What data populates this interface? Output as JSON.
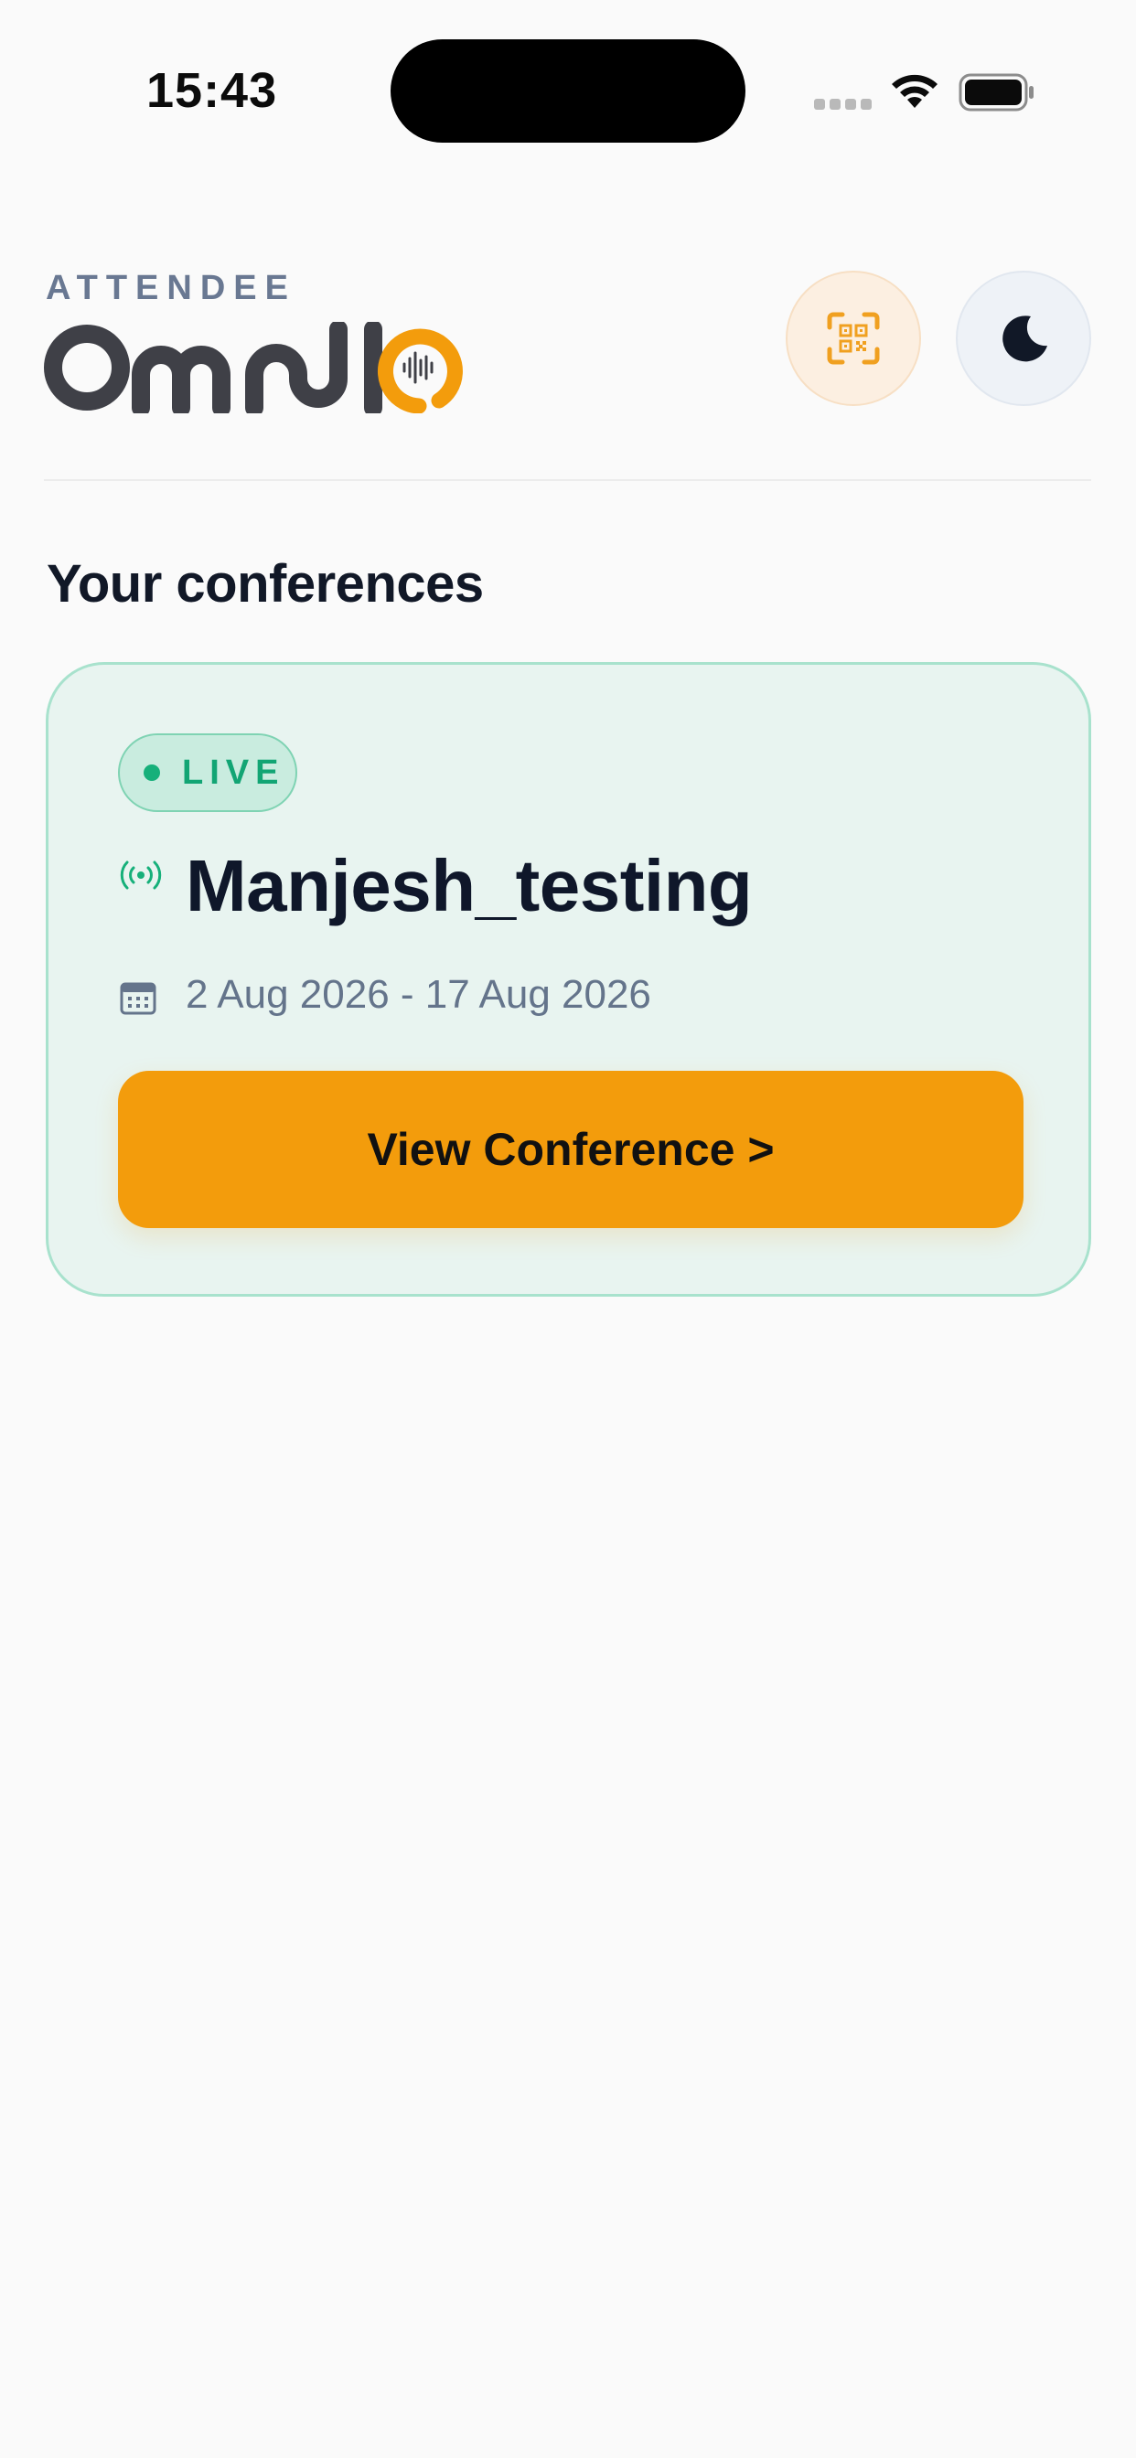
{
  "status_bar": {
    "time": "15:43",
    "icons": [
      "cellular-signal-icon",
      "wifi-icon",
      "battery-icon"
    ]
  },
  "header": {
    "brand_sub": "ATTENDEE",
    "brand_name": "OMNIO",
    "brand_colors": {
      "wordmark": "#3f4047",
      "accent": "#f39c0c"
    },
    "qr_button_icon": "qr-scan-icon",
    "theme_button_icon": "moon-icon"
  },
  "main": {
    "section_title": "Your conferences",
    "conferences": [
      {
        "status": "LIVE",
        "status_icon": "broadcast-icon",
        "name": "Manjesh_testing",
        "date_icon": "calendar-icon",
        "dates": "2 Aug 2026 - 17 Aug 2026",
        "action_label": "View Conference >"
      }
    ]
  },
  "colors": {
    "background": "#fafafa",
    "primary": "#f39c0c",
    "live_green": "#16b07a",
    "card_bg": "#e8f4f0",
    "card_border": "#a8e2cd",
    "title": "#0f172a",
    "muted": "#64748b"
  }
}
